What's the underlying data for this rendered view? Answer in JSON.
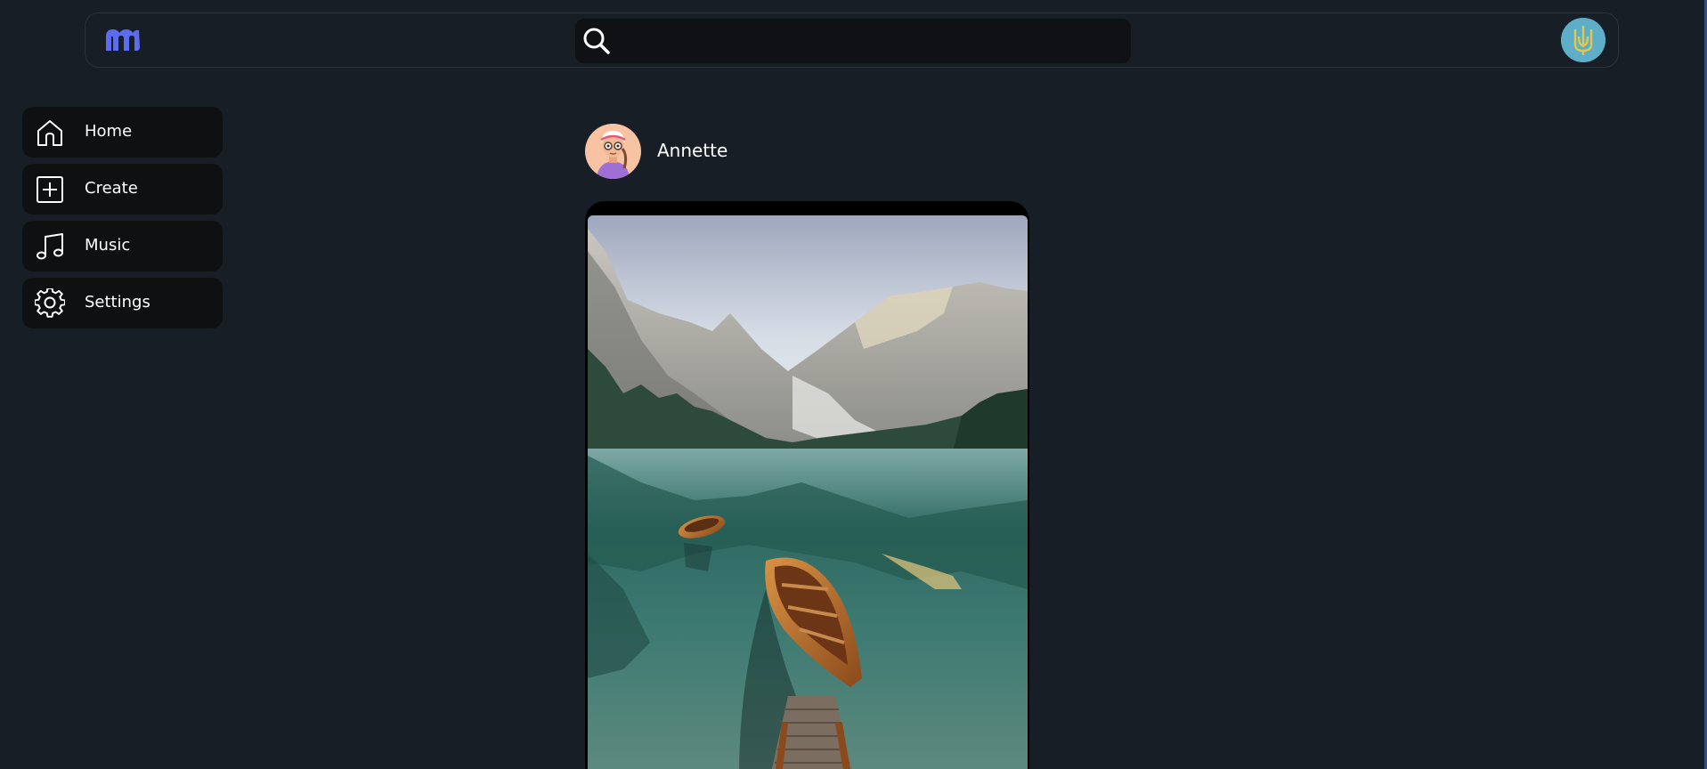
{
  "app": {
    "logo": "m-logo",
    "accent": "#5b6cf0"
  },
  "header": {
    "search": {
      "icon": "search-icon",
      "placeholder": "",
      "value": ""
    },
    "user_avatar": {
      "icon": "trident-icon",
      "color": "#5faec7"
    }
  },
  "sidebar": {
    "items": [
      {
        "label": "Home",
        "icon": "home-icon"
      },
      {
        "label": "Create",
        "icon": "plus-square-icon"
      },
      {
        "label": "Music",
        "icon": "music-note-icon"
      },
      {
        "label": "Settings",
        "icon": "gear-icon"
      }
    ]
  },
  "post": {
    "author": "Annette",
    "image": "lake-mountains-boats-photo"
  }
}
